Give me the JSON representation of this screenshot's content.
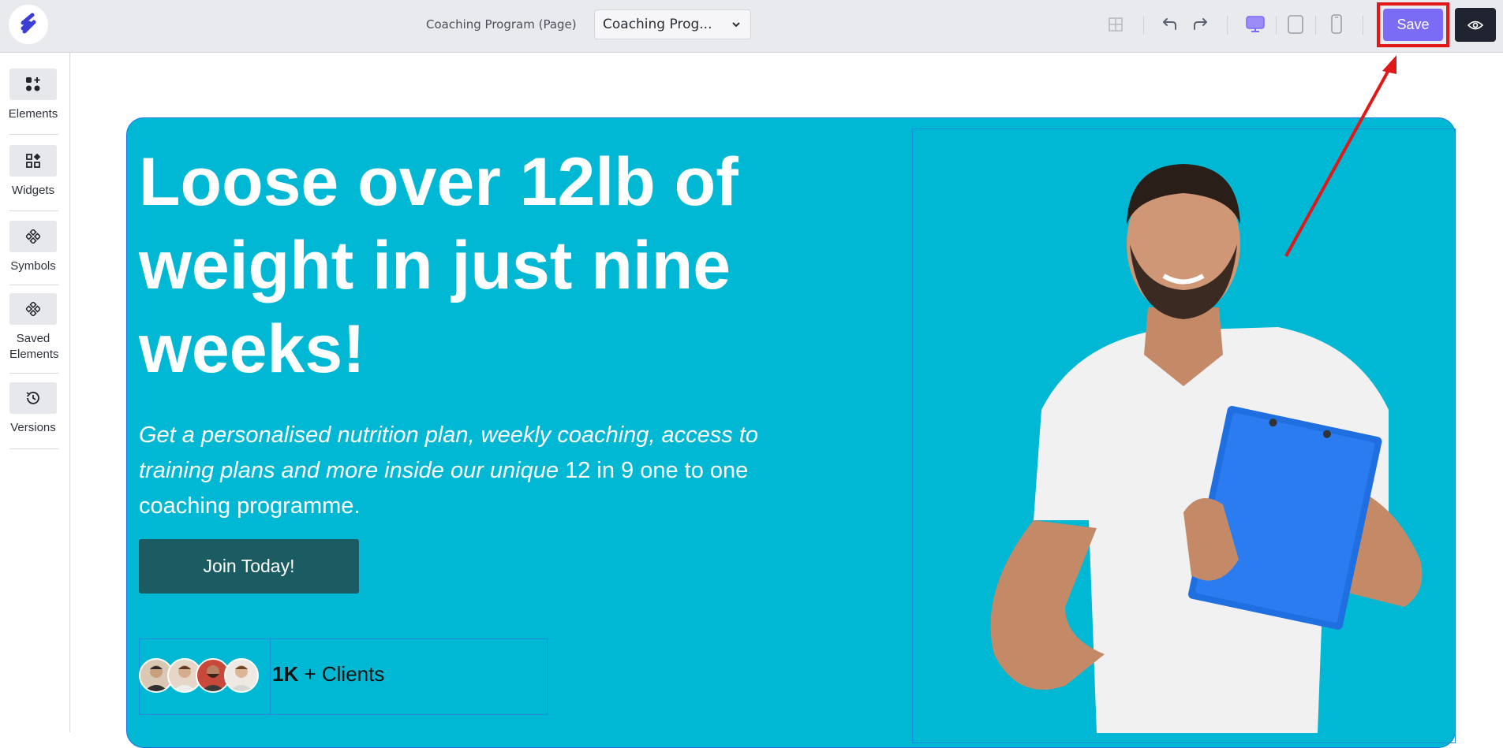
{
  "topbar": {
    "page_label": "Coaching Program (Page)",
    "page_select_value": "Coaching Prog...",
    "save_label": "Save",
    "icons": [
      "layout-grid-icon",
      "undo-icon",
      "redo-icon",
      "desktop-icon",
      "tablet-icon",
      "mobile-icon",
      "eye-icon"
    ]
  },
  "sidebar": {
    "items": [
      {
        "label": "Elements",
        "icon": "elements-icon"
      },
      {
        "label": "Widgets",
        "icon": "widgets-icon"
      },
      {
        "label": "Symbols",
        "icon": "symbols-icon"
      },
      {
        "label": "Saved Elements",
        "icon": "saved-elements-icon"
      },
      {
        "label": "Versions",
        "icon": "history-icon"
      }
    ]
  },
  "hero": {
    "headline": "Loose over 12lb of weight in just nine weeks!",
    "subtext_italic": "Get a personalised nutrition plan, weekly coaching, access to training plans and more inside our unique",
    "subtext_regular": " 12 in 9 one to one coaching programme.",
    "cta_label": "Join Today!",
    "clients_count": "1K",
    "clients_suffix": " + Clients"
  },
  "colors": {
    "hero_bg": "#00b8d4",
    "save_bg": "#7b6cf6",
    "cta_bg": "#1b5c63",
    "annotation": "#e01818"
  }
}
